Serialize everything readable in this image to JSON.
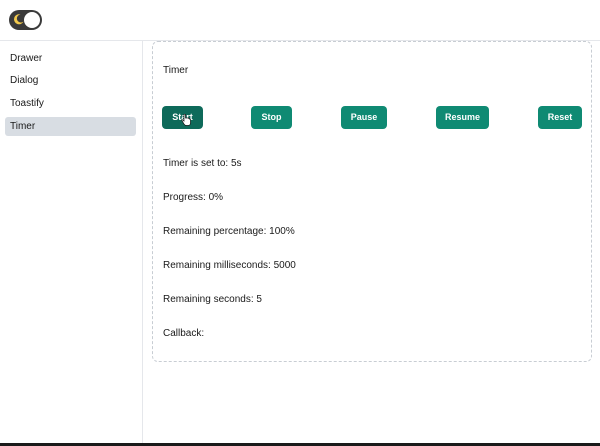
{
  "header": {
    "theme_toggle_icon": "moon-icon"
  },
  "sidebar": {
    "items": [
      {
        "label": "Drawer"
      },
      {
        "label": "Dialog"
      },
      {
        "label": "Toastify"
      },
      {
        "label": "Timer",
        "active": true
      }
    ]
  },
  "main": {
    "title": "Timer",
    "buttons": {
      "start": "Start",
      "stop": "Stop",
      "pause": "Pause",
      "resume": "Resume",
      "reset": "Reset"
    },
    "status": {
      "timer_set": "Timer is set to: 5s",
      "progress": "Progress: 0%",
      "remaining_percentage": "Remaining percentage: 100%",
      "remaining_ms": "Remaining milliseconds: 5000",
      "remaining_seconds": "Remaining seconds: 5",
      "callback": "Callback:"
    }
  },
  "colors": {
    "accent": "#0f8a73",
    "accent_pressed": "#0e6a5a",
    "active_nav": "#d8dde3",
    "toggle_bg": "#3a3a3a",
    "moon": "#f2c94c"
  }
}
